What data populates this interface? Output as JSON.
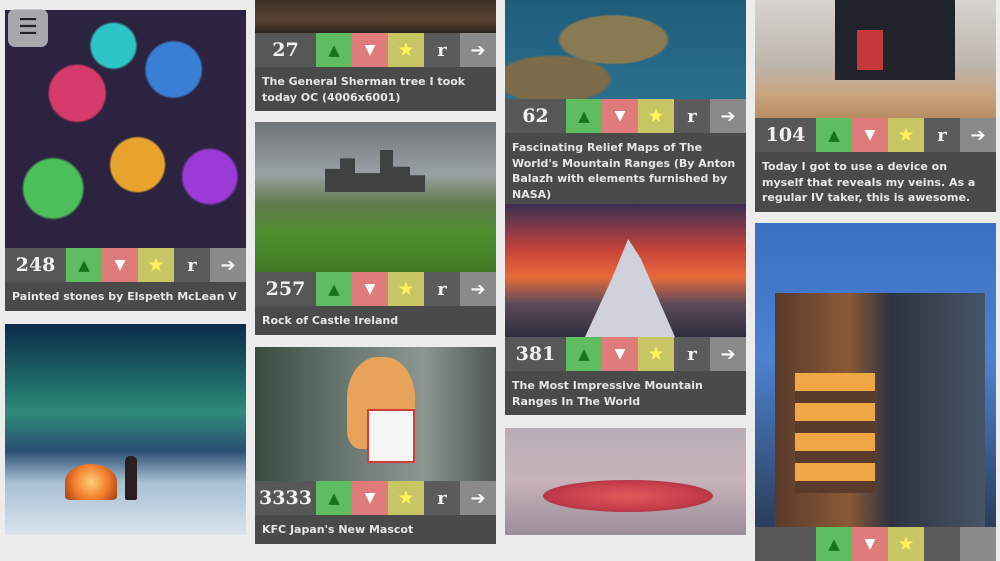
{
  "menu": {
    "icon": "hamburger-menu-icon",
    "glyph": "☰"
  },
  "vote_glyphs": {
    "upvote": "▲",
    "downvote": "▼",
    "favorite": "★",
    "reddit": "r",
    "open": "➔"
  },
  "colors": {
    "upvote": "#5ebd61",
    "downvote": "#e07b7b",
    "favorite": "#c8c565",
    "card": "#4a4a4a"
  },
  "posts": [
    {
      "score": "248",
      "title": "Painted stones by Elspeth McLean V"
    },
    {
      "score": "",
      "title": ""
    },
    {
      "score": "27",
      "title": "The General Sherman tree I took today OC (4006x6001)"
    },
    {
      "score": "257",
      "title": "Rock of Castle Ireland"
    },
    {
      "score": "3333",
      "title": "KFC Japan's New Mascot"
    },
    {
      "score": "62",
      "title": "Fascinating Relief Maps of The World's Mountain Ranges (By Anton Balazh with elements furnished by NASA)"
    },
    {
      "score": "381",
      "title": "The Most Impressive Mountain Ranges In The World"
    },
    {
      "score": "",
      "title": ""
    },
    {
      "score": "104",
      "title": "Today I got to use a device on myself that reveals my veins. As a regular IV taker, this is awesome."
    },
    {
      "score": "",
      "title": ""
    }
  ]
}
